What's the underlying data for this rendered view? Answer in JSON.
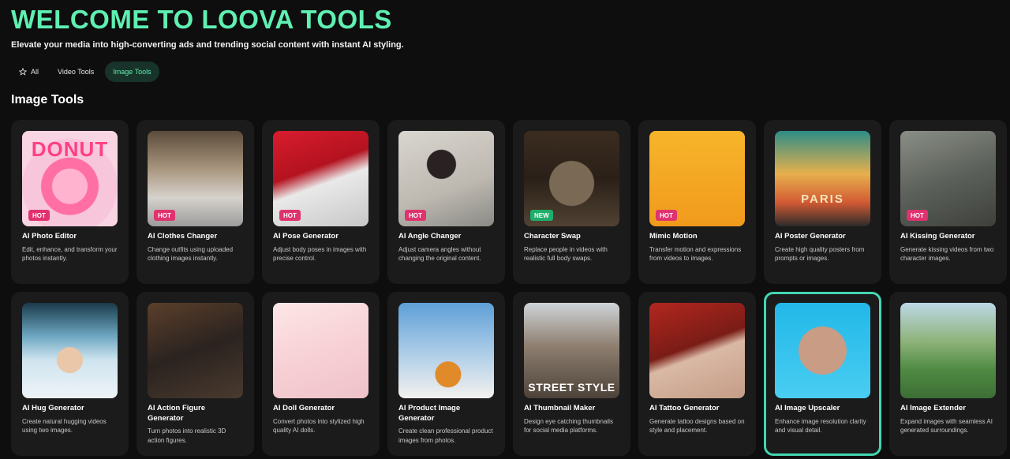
{
  "header": {
    "title": "WELCOME TO LOOVA TOOLS",
    "subtitle": "Elevate your media into high-converting ads and trending social content with instant AI styling."
  },
  "tabs": [
    {
      "label": "All",
      "icon": "star-icon",
      "active": false
    },
    {
      "label": "Video Tools",
      "active": false
    },
    {
      "label": "Image Tools",
      "active": true
    }
  ],
  "section": {
    "title": "Image Tools"
  },
  "colors": {
    "accent": "#5ff0b2",
    "hot_badge": "#e0326e",
    "new_badge": "#1fae6a",
    "selected_outline": "#43d6b0"
  },
  "cards": [
    {
      "name": "AI Photo Editor",
      "desc": "Edit, enhance, and transform your photos instantly.",
      "badge": "HOT",
      "thumb_text": "DONUT"
    },
    {
      "name": "AI Clothes Changer",
      "desc": "Change outfits using uploaded clothing images instantly.",
      "badge": "HOT"
    },
    {
      "name": "AI Pose Generator",
      "desc": "Adjust body poses in images with precise control.",
      "badge": "HOT"
    },
    {
      "name": "AI Angle Changer",
      "desc": "Adjust camera angles without changing the original content.",
      "badge": "HOT"
    },
    {
      "name": "Character Swap",
      "desc": "Replace people in videos with realistic full body swaps.",
      "badge": "NEW"
    },
    {
      "name": "Mimic Motion",
      "desc": "Transfer motion and expressions from videos to images.",
      "badge": "HOT"
    },
    {
      "name": "AI Poster Generator",
      "desc": "Create high quality posters from prompts or images.",
      "badge": "",
      "thumb_text": "PARIS"
    },
    {
      "name": "AI Kissing Generator",
      "desc": "Generate kissing videos from two character images.",
      "badge": "HOT"
    },
    {
      "name": "AI Hug Generator",
      "desc": "Create natural hugging videos using two images.",
      "badge": ""
    },
    {
      "name": "AI Action Figure Generator",
      "desc": "Turn photos into realistic 3D action figures.",
      "badge": ""
    },
    {
      "name": "AI Doll Generator",
      "desc": "Convert photos into stylized high quality AI dolls.",
      "badge": ""
    },
    {
      "name": "AI Product Image Generator",
      "desc": "Create clean professional product images from photos.",
      "badge": ""
    },
    {
      "name": "AI Thumbnail Maker",
      "desc": "Design eye catching thumbnails for social media platforms.",
      "badge": "",
      "thumb_text": "STREET STYLE"
    },
    {
      "name": "AI Tattoo Generator",
      "desc": "Generate tattoo designs based on style and placement.",
      "badge": ""
    },
    {
      "name": "AI Image Upscaler",
      "desc": "Enhance image resolution clarity and visual detail.",
      "badge": "",
      "selected": true
    },
    {
      "name": "AI Image Extender",
      "desc": "Expand images with seamless AI generated surroundings.",
      "badge": ""
    }
  ]
}
